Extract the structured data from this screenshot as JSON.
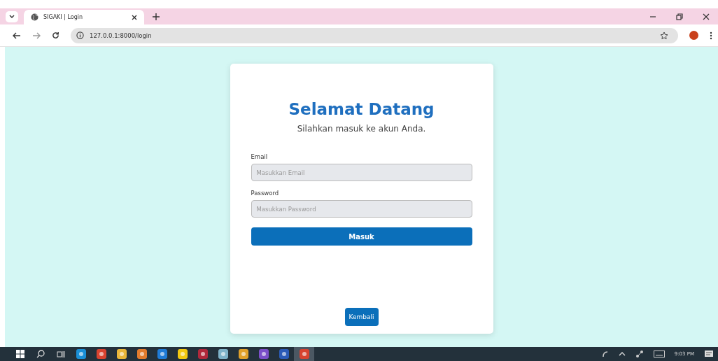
{
  "browser": {
    "tabs": [
      {
        "title": "SIGAKI | Login",
        "selected": true
      }
    ],
    "address": "127.0.0.1:8000/login"
  },
  "login": {
    "title": "Selamat Datang",
    "subtitle": "Silahkan masuk ke akun Anda.",
    "fields": [
      {
        "label": "Email",
        "placeholder": "Masukkan Email"
      },
      {
        "label": "Password",
        "placeholder": "Masukkan Password"
      }
    ],
    "submit": "Masuk",
    "back": "Kembali"
  },
  "taskbar": {
    "time": "9:03 PM"
  }
}
